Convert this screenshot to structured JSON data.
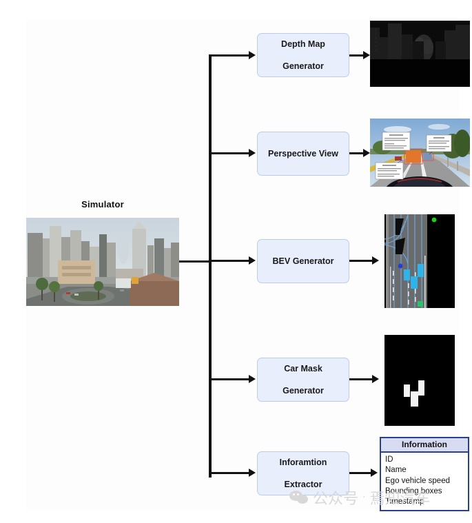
{
  "diagram": {
    "source": {
      "label": "Simulator",
      "image_name": "simulator-city-scene"
    },
    "nodes": [
      {
        "id": "depth-map-generator",
        "label_lines": [
          "Depth Map",
          "Generator"
        ]
      },
      {
        "id": "perspective-view",
        "label_lines": [
          "Perspective View"
        ]
      },
      {
        "id": "bev-generator",
        "label_lines": [
          "BEV Generator"
        ]
      },
      {
        "id": "car-mask-generator",
        "label_lines": [
          "Car Mask",
          "Generator"
        ]
      },
      {
        "id": "information-extractor",
        "label_lines": [
          "Inforamtion",
          "Extractor"
        ]
      }
    ],
    "outputs": [
      {
        "id": "depth-map-image",
        "kind": "image"
      },
      {
        "id": "perspective-view-image",
        "kind": "image"
      },
      {
        "id": "bev-image",
        "kind": "image"
      },
      {
        "id": "car-mask-image",
        "kind": "image"
      },
      {
        "id": "information-table",
        "kind": "table"
      }
    ],
    "information_table": {
      "header": "Information",
      "rows": [
        "ID",
        "Name",
        "Ego vehicle speed",
        "Bounding boxes",
        "Timestamp"
      ]
    },
    "colors": {
      "node_fill": "#e8eefc",
      "node_border": "#b9cbee",
      "connector": "#111111",
      "table_border": "#2b3f8f",
      "table_header_fill": "#d7dcf2",
      "panel_background": "#fdfdfd"
    }
  },
  "watermark": {
    "text": "公众号",
    "separator": "·",
    "account": "焉知汽车"
  }
}
